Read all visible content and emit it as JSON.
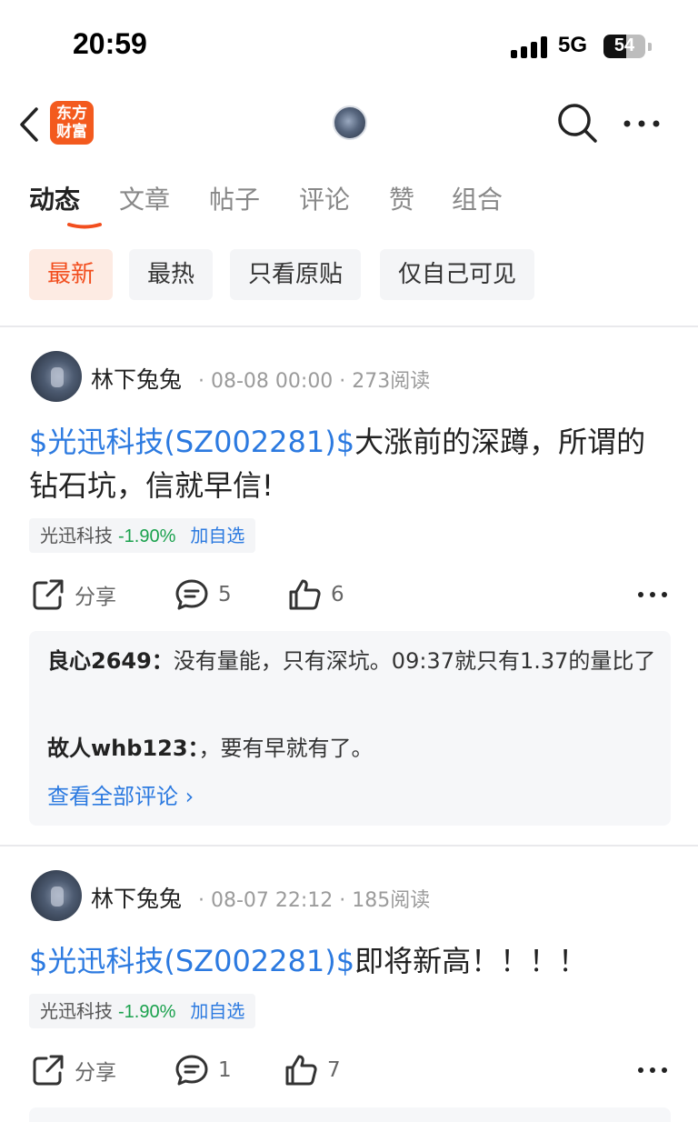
{
  "status_bar": {
    "time": "20:59",
    "network": "5G",
    "battery": "54",
    "battery_level": 0.54
  },
  "header": {
    "logo_line1": "东方",
    "logo_line2": "财富"
  },
  "tabs": [
    {
      "label": "动态",
      "active": true
    },
    {
      "label": "文章",
      "active": false
    },
    {
      "label": "帖子",
      "active": false
    },
    {
      "label": "评论",
      "active": false
    },
    {
      "label": "赞",
      "active": false
    },
    {
      "label": "组合",
      "active": false
    }
  ],
  "filters": [
    {
      "label": "最新",
      "active": true
    },
    {
      "label": "最热",
      "active": false
    },
    {
      "label": "只看原贴",
      "active": false
    },
    {
      "label": "仅自己可见",
      "active": false
    }
  ],
  "posts": [
    {
      "author": "林下兔兔",
      "meta": "· 08-08 00:00 · 273阅读",
      "stock_link": "$光迅科技(SZ002281)$",
      "text": "大涨前的深蹲，所谓的钻石坑，信就早信!",
      "tag": {
        "name": "光迅科技",
        "change": "-1.90%",
        "add": "加自选"
      },
      "actions": {
        "share": "分享",
        "comments": "5",
        "likes": "6"
      },
      "comments": [
        {
          "who": "良心2649：",
          "text": "没有量能，只有深坑。09:37就只有1.37的量比了"
        },
        {
          "who": "故人whb123：",
          "text": "，要有早就有了。"
        }
      ],
      "see_all": "查看全部评论 ›"
    },
    {
      "author": "林下兔兔",
      "meta": "· 08-07 22:12 · 185阅读",
      "stock_link": "$光迅科技(SZ002281)$",
      "text": "即将新高！！！！",
      "tag": {
        "name": "光迅科技",
        "change": "-1.90%",
        "add": "加自选"
      },
      "actions": {
        "share": "分享",
        "comments": "1",
        "likes": "7"
      }
    }
  ],
  "colors": {
    "accent": "#f24e1e",
    "link": "#2c7ae0",
    "fall": "#1aa14d",
    "brand": "#f35a1e"
  },
  "icons": [
    "back-chevron-icon",
    "search-icon",
    "more-dots-icon",
    "share-icon",
    "comment-icon",
    "like-icon"
  ]
}
